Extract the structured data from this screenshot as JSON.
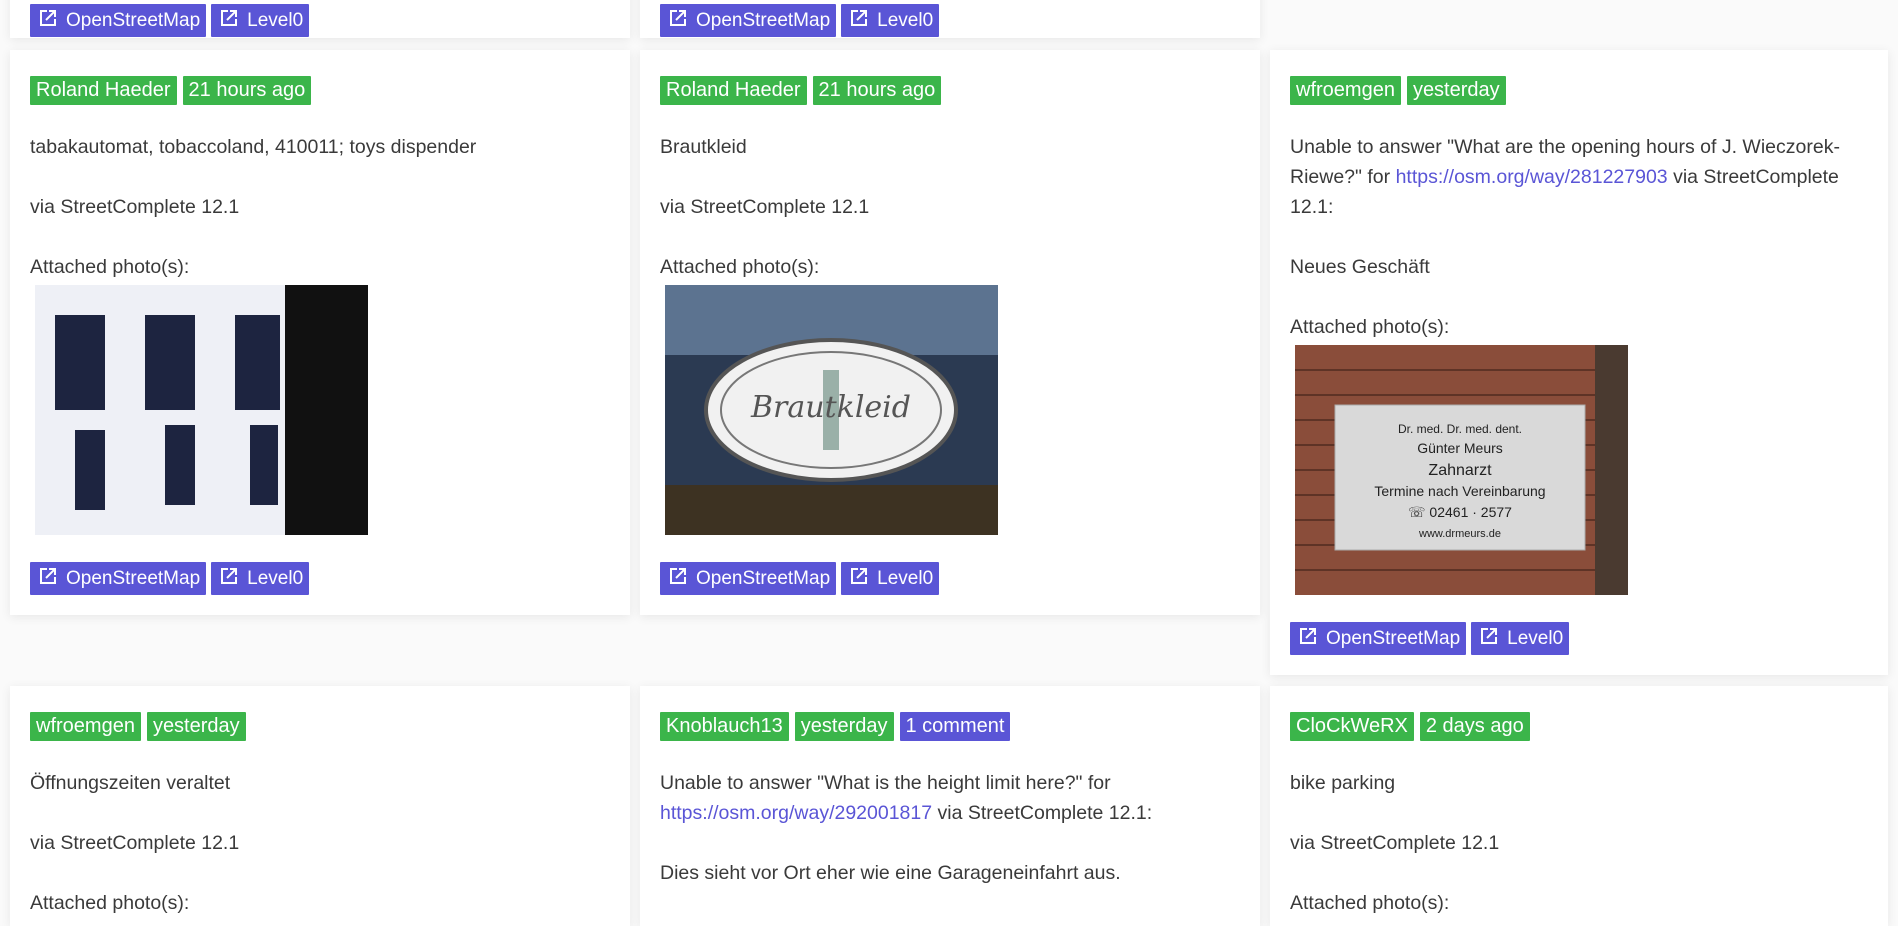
{
  "labels": {
    "via": "via StreetComplete 12.1",
    "via_colon": "via StreetComplete 12.1:",
    "attached": "Attached photo(s):",
    "osm": "OpenStreetMap",
    "level0": "Level0"
  },
  "cards": [
    {
      "user": "Roland Haeder",
      "time": "21 hours ago",
      "text": "tabakautomat, tobaccoland, 410011; toys dispender"
    },
    {
      "user": "Roland Haeder",
      "time": "21 hours ago",
      "text": "Brautkleid",
      "photo_text": "Brautkleid"
    },
    {
      "user": "wfroemgen",
      "time": "yesterday",
      "text_pre": "Unable to answer \"What are the opening hours of J. Wieczorek-Riewe?\" for",
      "link": "https://osm.org/way/281227903",
      "text_post": "via StreetComplete 12.1:",
      "note": "Neues Geschäft",
      "sign": [
        "Dr. med. Dr. med. dent.",
        "Günter Meurs",
        "Zahnarzt",
        "Termine nach Vereinbarung",
        "☏ 02461 · 2577",
        "www.drmeurs.de"
      ]
    },
    {
      "user": "wfroemgen",
      "time": "yesterday",
      "text": "Öffnungszeiten veraltet"
    },
    {
      "user": "Knoblauch13",
      "time": "yesterday",
      "comments": "1 comment",
      "text_pre": "Unable to answer \"What is the height limit here?\" for",
      "link": "https://osm.org/way/292001817",
      "text_post": "via StreetComplete 12.1:",
      "note": "Dies sieht vor Ort eher wie eine Garageneinfahrt aus."
    },
    {
      "user": "CloCkWeRX",
      "time": "2 days ago",
      "text": "bike parking"
    }
  ]
}
